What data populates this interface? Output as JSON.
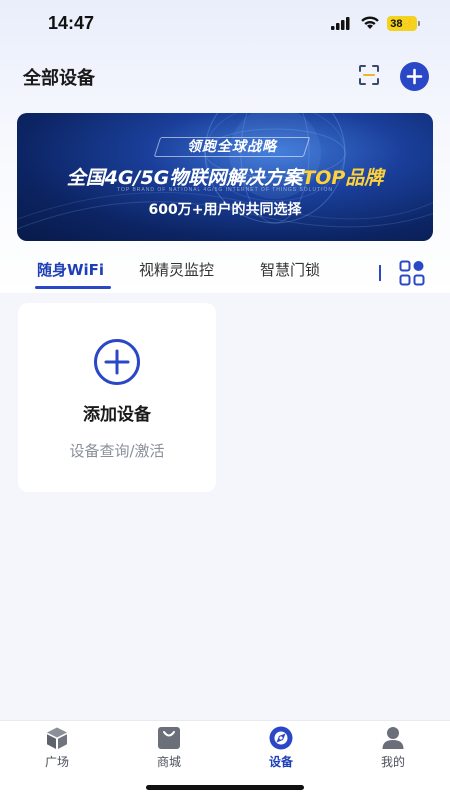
{
  "status_bar": {
    "time": "14:47",
    "battery": "38"
  },
  "header": {
    "title": "全部设备",
    "scan_icon": "scan-icon",
    "add_icon": "plus-circle-icon"
  },
  "banner": {
    "kicker": "领跑全球战略",
    "headline_prefix": "全国4G/5G物联网解决方案",
    "headline_highlight": "TOP品牌",
    "english_line": "TOP BRAND OF NATIONAL 4G/5G INTERNET OF THINGS SOLUTION",
    "tagline": "600万+用户的共同选择"
  },
  "tabs": [
    {
      "label": "随身WiFi",
      "active": true
    },
    {
      "label": "视精灵监控",
      "active": false
    },
    {
      "label": "智慧门锁",
      "active": false
    }
  ],
  "add_card": {
    "title": "添加设备",
    "subtitle": "设备查询/激活"
  },
  "bottom_nav": [
    {
      "label": "广场",
      "icon": "cube-icon",
      "active": false
    },
    {
      "label": "商城",
      "icon": "shopping-bag-icon",
      "active": false
    },
    {
      "label": "设备",
      "icon": "compass-icon",
      "active": true
    },
    {
      "label": "我的",
      "icon": "person-icon",
      "active": false
    }
  ],
  "colors": {
    "accent": "#2a47c6",
    "active_text": "#1f3fb6",
    "battery": "#f3d31c",
    "banner_highlight": "#ffd23a"
  }
}
